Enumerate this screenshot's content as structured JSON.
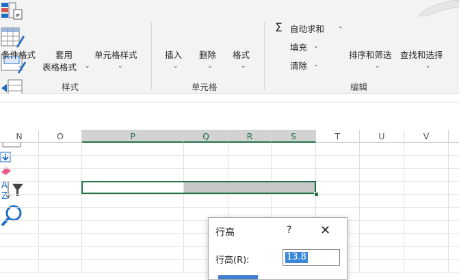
{
  "ribbon": {
    "styles": {
      "conditional_format": "条件格式",
      "table_format_line1": "套用",
      "table_format_line2": "表格格式",
      "cell_styles": "单元格样式",
      "group_label": "样式"
    },
    "cells": {
      "insert": "插入",
      "delete": "删除",
      "format": "格式",
      "group_label": "单元格"
    },
    "editing": {
      "autosum": "自动求和",
      "fill": "填充",
      "clear": "清除",
      "sort_filter": "排序和筛选",
      "find_select": "查找和选择",
      "group_label": "编辑"
    }
  },
  "columns": [
    {
      "label": "N",
      "selected": false
    },
    {
      "label": "O",
      "selected": false
    },
    {
      "label": "P",
      "selected": true
    },
    {
      "label": "Q",
      "selected": true
    },
    {
      "label": "R",
      "selected": true
    },
    {
      "label": "S",
      "selected": true
    },
    {
      "label": "T",
      "selected": false
    },
    {
      "label": "U",
      "selected": false
    },
    {
      "label": "V",
      "selected": false
    }
  ],
  "dialog": {
    "title": "行高",
    "help": "?",
    "close": "✕",
    "field_label": "行高(R):",
    "field_value": "13.8"
  },
  "colors": {
    "excel_green": "#217346",
    "selection_gray": "#c8c8c8",
    "highlight_blue": "#3a86d8"
  }
}
